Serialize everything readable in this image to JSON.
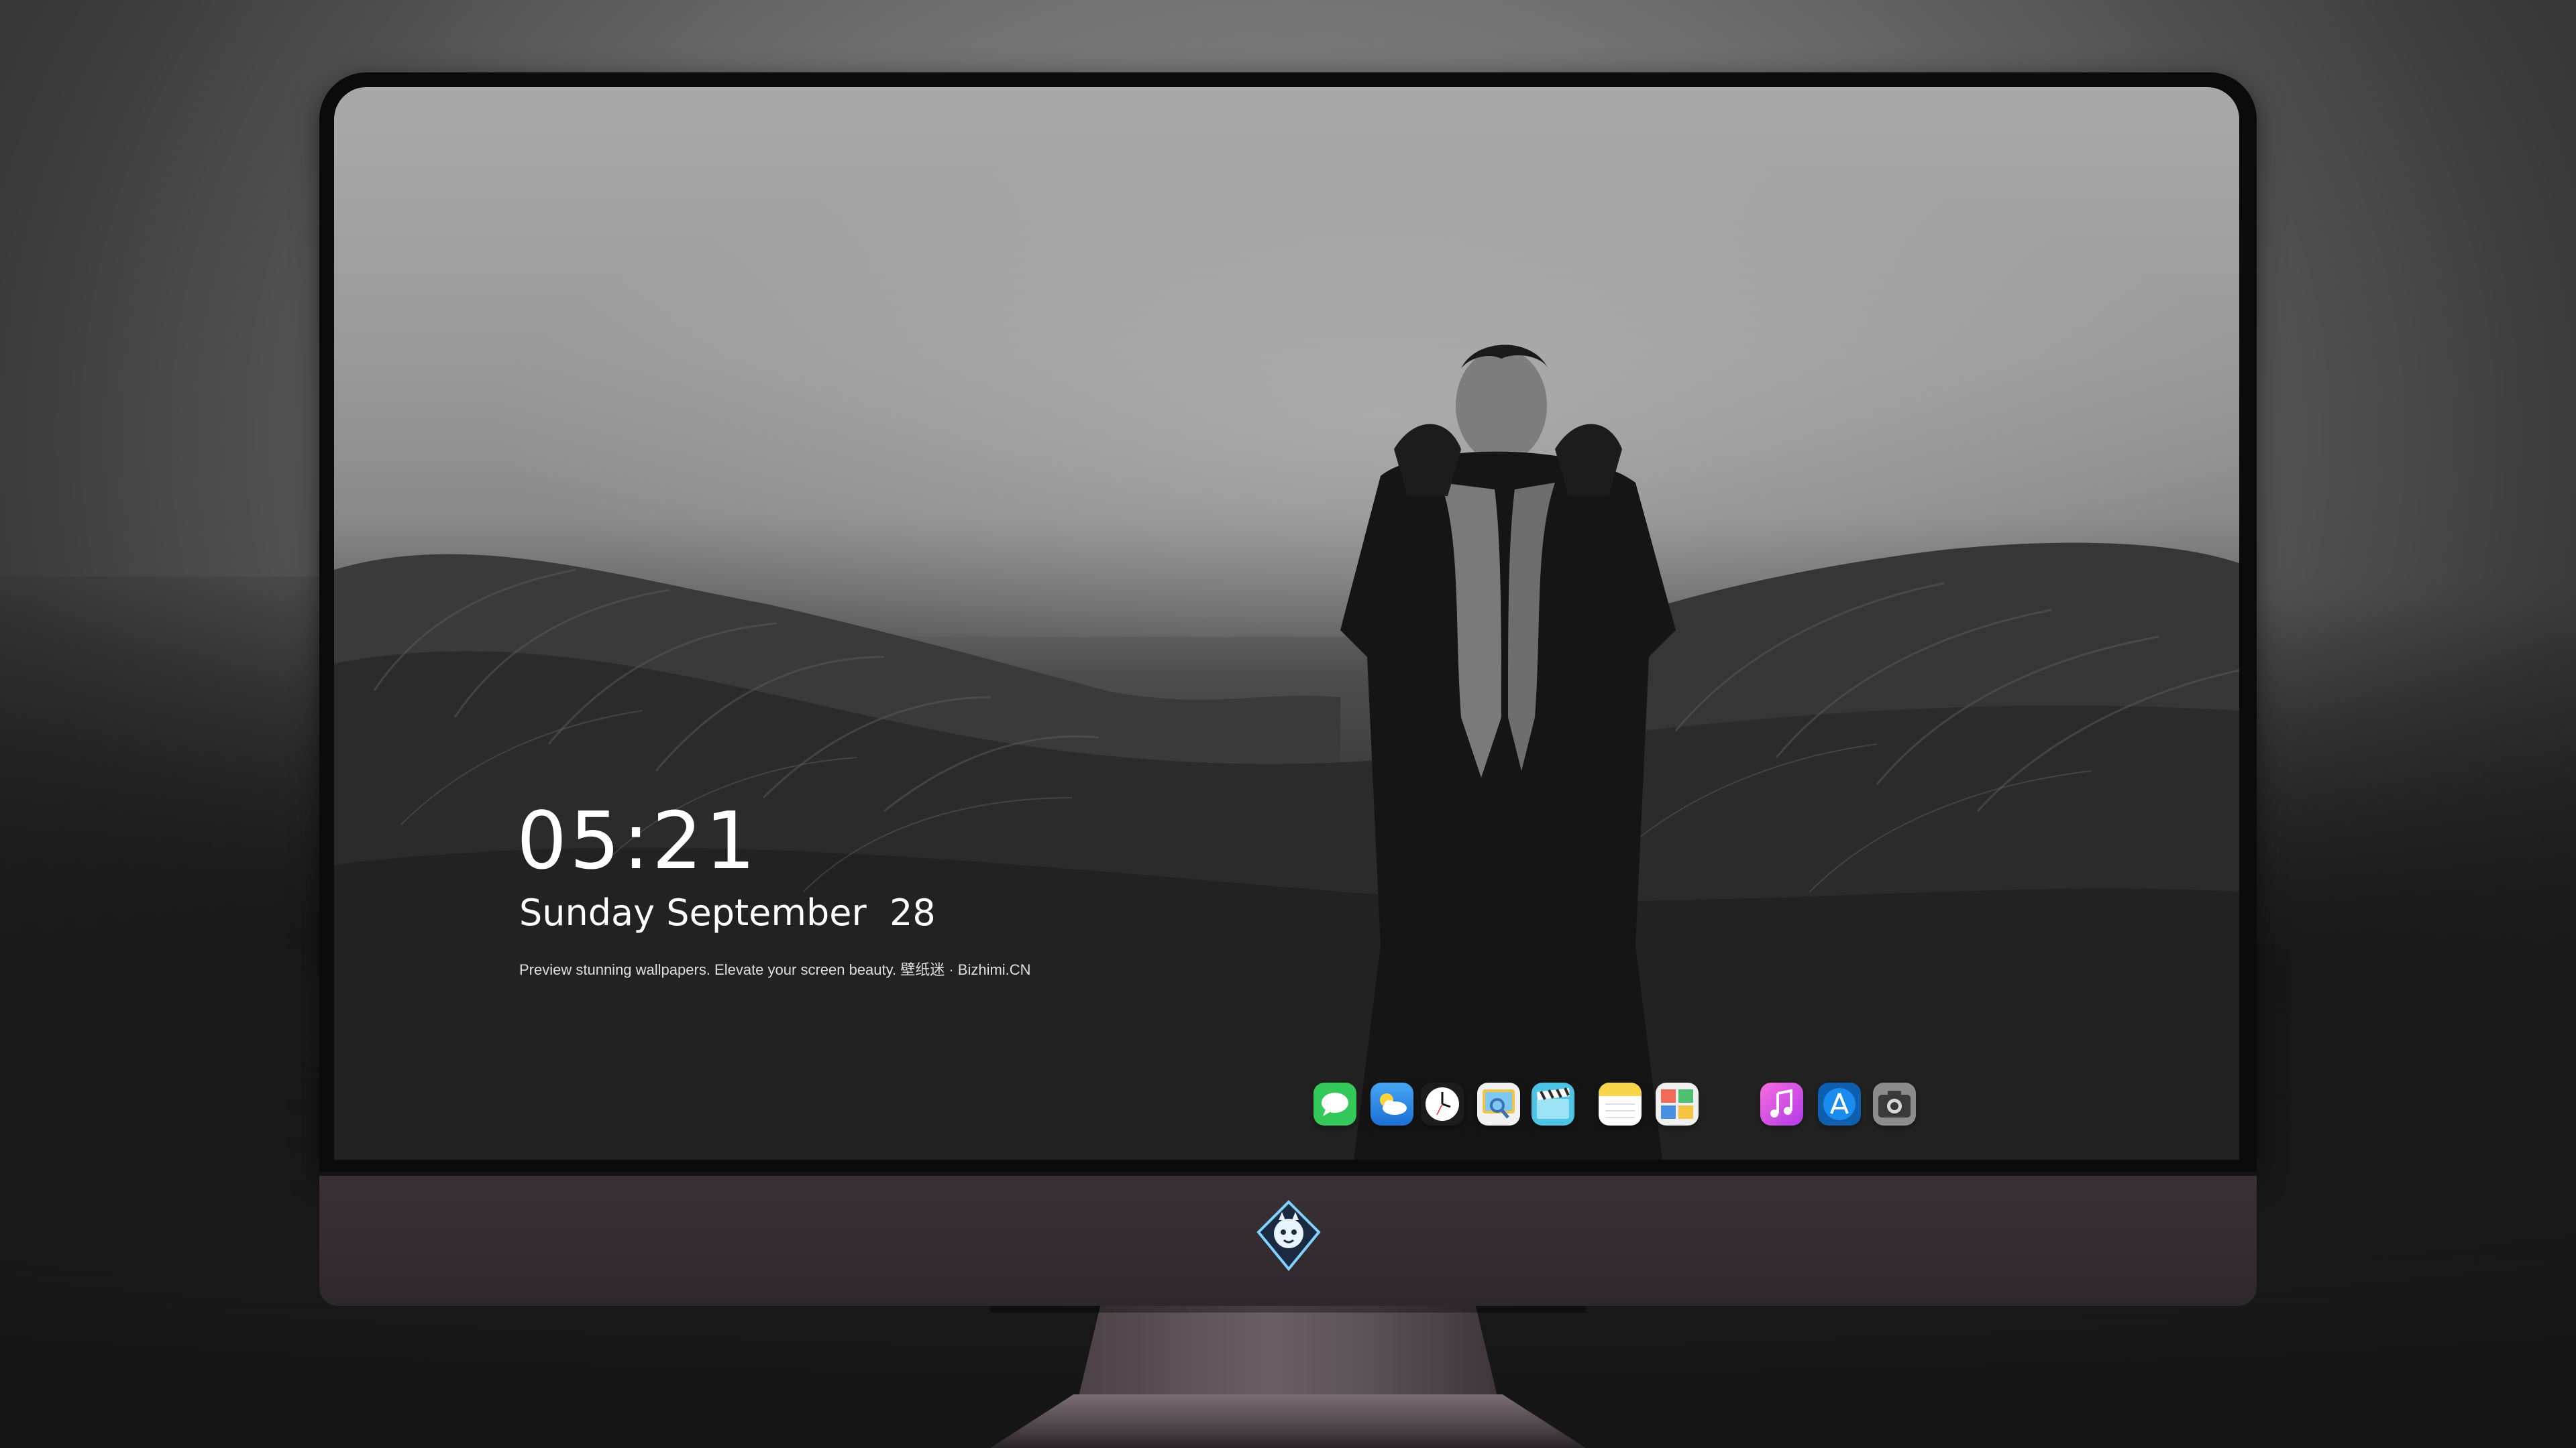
{
  "lock_screen": {
    "time": "05:21",
    "date": "Sunday September  28",
    "tagline": "Preview stunning wallpapers. Elevate your screen beauty. 壁纸迷 · Bizhimi.CN"
  },
  "dock": {
    "apps": [
      {
        "name": "messages-icon",
        "color": "#2fd158"
      },
      {
        "name": "weather-icon",
        "color": "#2f8de4"
      },
      {
        "name": "clock-icon",
        "color": "#1c1c1e"
      },
      {
        "name": "preview-icon",
        "color": "#f4c542"
      },
      {
        "name": "final-cut-clapper-icon",
        "color": "#59c7e8"
      },
      {
        "name": "notes-icon",
        "color": "#f7d54a"
      },
      {
        "name": "photo-booth-icon",
        "color": "#e8e8e8"
      },
      {
        "name": "itunes-music-icon",
        "color": "#e85ad9"
      },
      {
        "name": "app-store-icon",
        "color": "#1a8cf0"
      },
      {
        "name": "camera-icon",
        "color": "#8c8c8c"
      }
    ]
  },
  "monitor": {
    "logo": "bizhimi-mascot-logo-icon"
  }
}
